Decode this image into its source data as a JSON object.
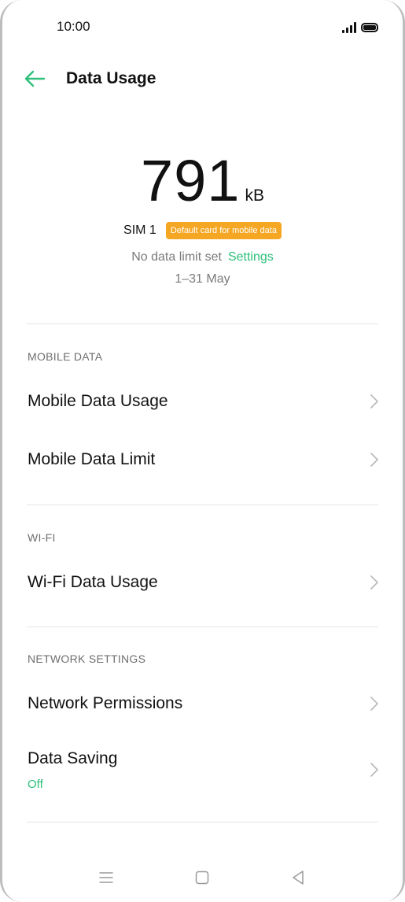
{
  "status_bar": {
    "time": "10:00",
    "icons": [
      "signal-icon",
      "battery-icon"
    ]
  },
  "header": {
    "back_icon": "arrow-left-icon",
    "title": "Data Usage"
  },
  "summary": {
    "value": "791",
    "unit": "kB",
    "sim_label": "SIM 1",
    "badge": "Default card for mobile data",
    "limit_text": "No data limit set",
    "settings_label": "Settings",
    "period": "1–31 May"
  },
  "sections": {
    "mobile_data": {
      "header": "MOBILE DATA",
      "items": [
        {
          "label": "Mobile Data Usage"
        },
        {
          "label": "Mobile Data Limit"
        }
      ]
    },
    "wifi": {
      "header": "WI-FI",
      "items": [
        {
          "label": "Wi-Fi Data Usage"
        }
      ]
    },
    "network_settings": {
      "header": "NETWORK SETTINGS",
      "items": [
        {
          "label": "Network Permissions"
        },
        {
          "label": "Data Saving",
          "sublabel": "Off"
        }
      ]
    }
  },
  "colors": {
    "accent": "#2ebf7a",
    "badge": "#f5a623",
    "secondary_text": "#7a7a7a"
  },
  "nav_bar": {
    "icons": [
      "menu-icon",
      "home-icon",
      "back-triangle-icon"
    ]
  }
}
